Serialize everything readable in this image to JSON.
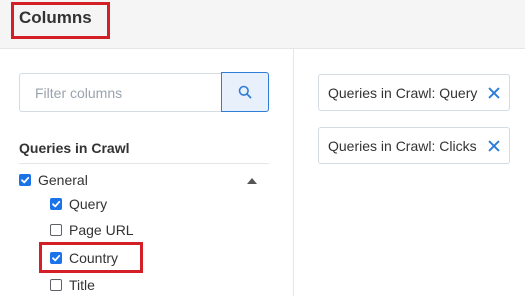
{
  "panel": {
    "title": "Columns"
  },
  "filter": {
    "placeholder": "Filter columns",
    "value": ""
  },
  "groups": [
    {
      "heading": "Queries in Crawl",
      "category": {
        "label": "General",
        "checked": true,
        "expanded": true
      },
      "items": [
        {
          "label": "Query",
          "checked": true
        },
        {
          "label": "Page URL",
          "checked": false
        },
        {
          "label": "Country",
          "checked": true
        },
        {
          "label": "Title",
          "checked": false
        }
      ]
    }
  ],
  "selected_columns": [
    {
      "label": "Queries in Crawl: Query"
    },
    {
      "label": "Queries in Crawl: Clicks"
    }
  ],
  "icons": {
    "search": "search-icon",
    "remove": "close-icon",
    "collapse": "chevron-up-icon",
    "check": "checkmark-icon"
  },
  "colors": {
    "accent": "#1a73e8",
    "highlight": "#d32027",
    "search_button_bg": "#e8f0fc"
  }
}
